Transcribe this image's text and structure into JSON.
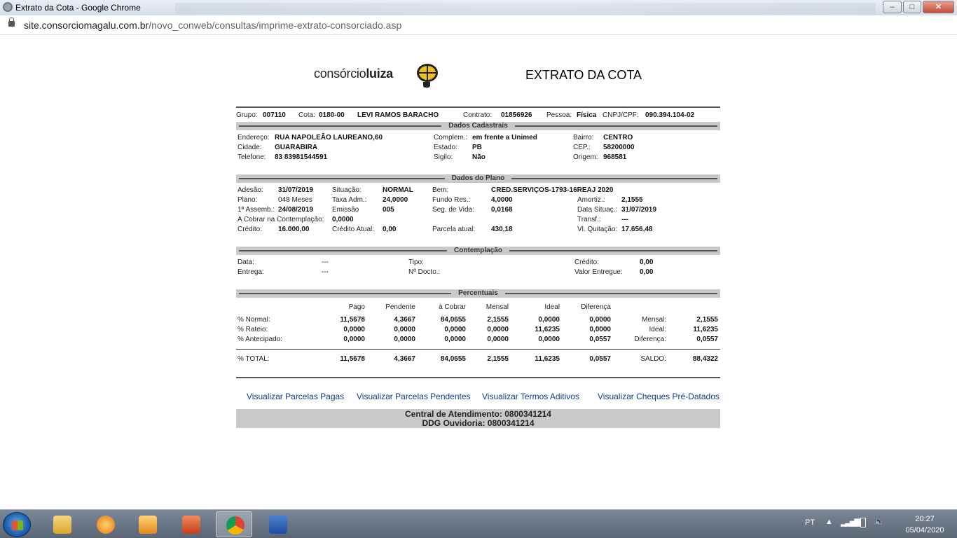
{
  "window": {
    "title": "Extrato da Cota - Google Chrome",
    "min": "–",
    "max": "□",
    "close": "✕"
  },
  "address": {
    "host": "site.consorciomagalu.com.br",
    "path": "/novo_conweb/consultas/imprime-extrato-consorciado.asp"
  },
  "logo": {
    "prefix": "consórcio",
    "bold": "luiza"
  },
  "doc_title": "EXTRATO DA COTA",
  "header": {
    "grupo_label": "Grupo:",
    "grupo": "007110",
    "cota_label": "Cota:",
    "cota": "0180-00",
    "nome": "LEVI RAMOS BARACHO",
    "contrato_label": "Contrato:",
    "contrato": "01856926",
    "pessoa_label": "Pessoa:",
    "pessoa": "Física",
    "cpf_label": "CNPJ/CPF:",
    "cpf": "090.394.104-02"
  },
  "cadastrais": {
    "title": "Dados Cadastrais",
    "endereco_label": "Endereço:",
    "endereco": "RUA NAPOLEÃO LAUREANO,60",
    "cidade_label": "Cidade:",
    "cidade": "GUARABIRA",
    "telefone_label": "Telefone:",
    "telefone": "83 83981544591",
    "complem_label": "Complem.:",
    "complem": "em frente a Unimed",
    "estado_label": "Estado:",
    "estado": "PB",
    "sigilo_label": "Sigilo:",
    "sigilo": "Não",
    "bairro_label": "Bairro:",
    "bairro": "CENTRO",
    "cep_label": "CEP.:",
    "cep": "58200000",
    "origem_label": "Origem:",
    "origem": "968581"
  },
  "plano": {
    "title": "Dados do Plano",
    "adesao_label": "Adesão:",
    "adesao": "31/07/2019",
    "plano_label": "Plano:",
    "plano": "048 Meses",
    "assemb_label": "1ª Assemb.:",
    "assemb": "24/08/2019",
    "acobrar_label": "A Cobrar na Contemplação:",
    "acobrar": "0,0000",
    "credito_label": "Crédito:",
    "credito": "16.000,00",
    "situacao_label": "Situação:",
    "situacao": "NORMAL",
    "taxa_label": "Taxa Adm.:",
    "taxa": "24,0000",
    "emissao_label": "Emissão",
    "emissao": "005",
    "credatual_label": "Crédito Atual:",
    "credatual": "0,00",
    "bem_label": "Bem:",
    "bem": "CRED.SERVIÇOS-1793-16REAJ 2020",
    "fundo_label": "Fundo Res.:",
    "fundo": "4,0000",
    "segvida_label": "Seg. de Vida:",
    "segvida": "0,0168",
    "parcela_label": "Parcela atual:",
    "parcela": "430,18",
    "amortiz_label": "Amortiz.:",
    "amortiz": "2,1555",
    "datasit_label": "Data Situaç.:",
    "datasit": "31/07/2019",
    "transf_label": "Transf.:",
    "transf": "---",
    "vlquit_label": "Vl. Quitação:",
    "vlquit": "17.656,48"
  },
  "contemplacao": {
    "title": "Contemplação",
    "data_label": "Data:",
    "data": "---",
    "entrega_label": "Entrega:",
    "entrega": "---",
    "tipo_label": "Tipo:",
    "docto_label": "Nº Docto.:",
    "credito_label": "Crédito:",
    "credito": "0,00",
    "valor_label": "Valor Entregue:",
    "valor": "0,00"
  },
  "percentuais": {
    "title": "Percentuais",
    "cols": [
      "Pago",
      "Pendente",
      "à Cobrar",
      "Mensal",
      "Ideal",
      "Diferença"
    ],
    "rows": [
      {
        "label": "% Normal:",
        "vals": [
          "11,5678",
          "4,3667",
          "84,0655",
          "2,1555",
          "0,0000",
          "0,0000"
        ],
        "side_label": "Mensal:",
        "side_val": "2,1555"
      },
      {
        "label": "% Rateio:",
        "vals": [
          "0,0000",
          "0,0000",
          "0,0000",
          "0,0000",
          "11,6235",
          "0,0000"
        ],
        "side_label": "Ideal:",
        "side_val": "11,6235"
      },
      {
        "label": "% Antecipado:",
        "vals": [
          "0,0000",
          "0,0000",
          "0,0000",
          "0,0000",
          "0,0000",
          "0,0557"
        ],
        "side_label": "Diferença:",
        "side_val": "0,0557"
      }
    ],
    "total": {
      "label": "% TOTAL:",
      "vals": [
        "11,5678",
        "4,3667",
        "84,0655",
        "2,1555",
        "11,6235",
        "0,0557"
      ],
      "side_label": "SALDO:",
      "side_val": "88,4322"
    }
  },
  "links": [
    "Visualizar Parcelas Pagas",
    "Visualizar Parcelas Pendentes",
    "Visualizar Termos Aditivos",
    "Visualizar Cheques Pré-Datados"
  ],
  "footer": {
    "line1": "Central de Atendimento: 0800341214",
    "line2": "DDG Ouvidoria: 0800341214"
  },
  "taskbar": {
    "lang": "PT",
    "time": "20:27",
    "date": "05/04/2020"
  }
}
